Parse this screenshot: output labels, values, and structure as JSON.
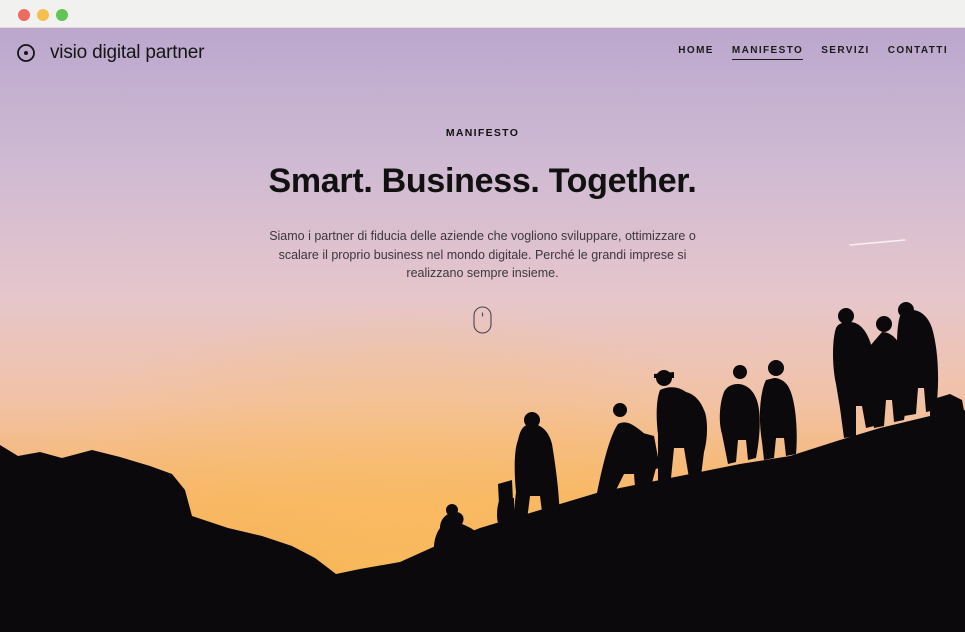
{
  "window": {
    "controls": [
      {
        "name": "close",
        "color": "#ed6b5f"
      },
      {
        "name": "minimize",
        "color": "#f5bf4f"
      },
      {
        "name": "maximize",
        "color": "#61c454"
      }
    ]
  },
  "brand": {
    "name": "visio digital partner",
    "logo_icon": "circle-dot-icon"
  },
  "nav": {
    "items": [
      {
        "label": "HOME",
        "active": false
      },
      {
        "label": "MANIFESTO",
        "active": true
      },
      {
        "label": "SERVIZI",
        "active": false
      },
      {
        "label": "CONTATTI",
        "active": false
      }
    ]
  },
  "hero": {
    "eyebrow": "MANIFESTO",
    "headline": "Smart. Business. Together.",
    "subtitle": "Siamo i partner di fiducia delle aziende che vogliono sviluppare, ottimizzare o scalare il proprio business nel mondo digitale. Perché le grandi imprese si realizzano sempre insieme.",
    "scroll_icon": "mouse-scroll-icon",
    "background": "sunset sky with hikers silhouettes",
    "colors": {
      "sky_top": "#c1acd0",
      "sky_mid": "#e9c3c2",
      "sky_bottom": "#f6b25d",
      "silhouette": "#0b090b"
    }
  }
}
